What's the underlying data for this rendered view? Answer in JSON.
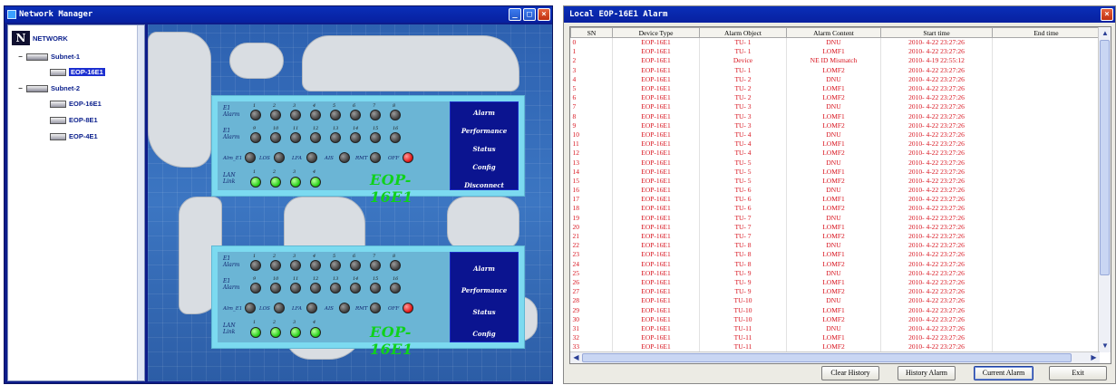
{
  "network_manager": {
    "title": "Network Manager",
    "tree": {
      "root": "NETWORK",
      "subnets": [
        {
          "label": "Subnet-1",
          "devices": [
            "EOP-16E1"
          ]
        },
        {
          "label": "Subnet-2",
          "devices": [
            "EOP-16E1",
            "EOP-8E1",
            "EOP-4E1"
          ]
        }
      ]
    },
    "panels": [
      {
        "model": "EOP-16E1",
        "row1_label": "E1\nAlarm",
        "row2_label": "E1\nAlarm",
        "row1_numbers": [
          "1",
          "2",
          "3",
          "4",
          "5",
          "6",
          "7",
          "8"
        ],
        "row2_numbers": [
          "9",
          "10",
          "11",
          "12",
          "13",
          "14",
          "15",
          "16"
        ],
        "status_labels": [
          "Alm_E1",
          "LOS",
          "LFA",
          "AIS",
          "RMT",
          "OFF"
        ],
        "lan_label": "LAN\nLink",
        "lan_numbers": [
          "1",
          "2",
          "3",
          "4"
        ],
        "menu": [
          "Alarm",
          "Performance",
          "Status",
          "Config",
          "Disconnect"
        ]
      },
      {
        "model": "EOP-16E1",
        "row1_label": "E1\nAlarm",
        "row2_label": "E1\nAlarm",
        "row1_numbers": [
          "1",
          "2",
          "3",
          "4",
          "5",
          "6",
          "7",
          "8"
        ],
        "row2_numbers": [
          "9",
          "10",
          "11",
          "12",
          "13",
          "14",
          "15",
          "16"
        ],
        "status_labels": [
          "Alm_E1",
          "LOS",
          "LFA",
          "AIS",
          "RMT",
          "OFF"
        ],
        "lan_label": "LAN\nLink",
        "lan_numbers": [
          "1",
          "2",
          "3",
          "4"
        ],
        "menu": [
          "Alarm",
          "Performance",
          "Status",
          "Config"
        ]
      }
    ]
  },
  "alarm_window": {
    "title": "Local EOP-16E1 Alarm",
    "columns": [
      "SN",
      "Device Type",
      "Alarm Object",
      "Alarm Content",
      "Start time",
      "End time"
    ],
    "rows": [
      [
        "0",
        "EOP-16E1",
        "TU- 1",
        "DNU",
        "2010- 4-22 23:27:26",
        ""
      ],
      [
        "1",
        "EOP-16E1",
        "TU- 1",
        "LOMF1",
        "2010- 4-22 23:27:26",
        ""
      ],
      [
        "2",
        "EOP-16E1",
        "Device",
        "NE ID Mismatch",
        "2010- 4-19 22:55:12",
        ""
      ],
      [
        "3",
        "EOP-16E1",
        "TU- 1",
        "LOMF2",
        "2010- 4-22 23:27:26",
        ""
      ],
      [
        "4",
        "EOP-16E1",
        "TU- 2",
        "DNU",
        "2010- 4-22 23:27:26",
        ""
      ],
      [
        "5",
        "EOP-16E1",
        "TU- 2",
        "LOMF1",
        "2010- 4-22 23:27:26",
        ""
      ],
      [
        "6",
        "EOP-16E1",
        "TU- 2",
        "LOMF2",
        "2010- 4-22 23:27:26",
        ""
      ],
      [
        "7",
        "EOP-16E1",
        "TU- 3",
        "DNU",
        "2010- 4-22 23:27:26",
        ""
      ],
      [
        "8",
        "EOP-16E1",
        "TU- 3",
        "LOMF1",
        "2010- 4-22 23:27:26",
        ""
      ],
      [
        "9",
        "EOP-16E1",
        "TU- 3",
        "LOMF2",
        "2010- 4-22 23:27:26",
        ""
      ],
      [
        "10",
        "EOP-16E1",
        "TU- 4",
        "DNU",
        "2010- 4-22 23:27:26",
        ""
      ],
      [
        "11",
        "EOP-16E1",
        "TU- 4",
        "LOMF1",
        "2010- 4-22 23:27:26",
        ""
      ],
      [
        "12",
        "EOP-16E1",
        "TU- 4",
        "LOMF2",
        "2010- 4-22 23:27:26",
        ""
      ],
      [
        "13",
        "EOP-16E1",
        "TU- 5",
        "DNU",
        "2010- 4-22 23:27:26",
        ""
      ],
      [
        "14",
        "EOP-16E1",
        "TU- 5",
        "LOMF1",
        "2010- 4-22 23:27:26",
        ""
      ],
      [
        "15",
        "EOP-16E1",
        "TU- 5",
        "LOMF2",
        "2010- 4-22 23:27:26",
        ""
      ],
      [
        "16",
        "EOP-16E1",
        "TU- 6",
        "DNU",
        "2010- 4-22 23:27:26",
        ""
      ],
      [
        "17",
        "EOP-16E1",
        "TU- 6",
        "LOMF1",
        "2010- 4-22 23:27:26",
        ""
      ],
      [
        "18",
        "EOP-16E1",
        "TU- 6",
        "LOMF2",
        "2010- 4-22 23:27:26",
        ""
      ],
      [
        "19",
        "EOP-16E1",
        "TU- 7",
        "DNU",
        "2010- 4-22 23:27:26",
        ""
      ],
      [
        "20",
        "EOP-16E1",
        "TU- 7",
        "LOMF1",
        "2010- 4-22 23:27:26",
        ""
      ],
      [
        "21",
        "EOP-16E1",
        "TU- 7",
        "LOMF2",
        "2010- 4-22 23:27:26",
        ""
      ],
      [
        "22",
        "EOP-16E1",
        "TU- 8",
        "DNU",
        "2010- 4-22 23:27:26",
        ""
      ],
      [
        "23",
        "EOP-16E1",
        "TU- 8",
        "LOMF1",
        "2010- 4-22 23:27:26",
        ""
      ],
      [
        "24",
        "EOP-16E1",
        "TU- 8",
        "LOMF2",
        "2010- 4-22 23:27:26",
        ""
      ],
      [
        "25",
        "EOP-16E1",
        "TU- 9",
        "DNU",
        "2010- 4-22 23:27:26",
        ""
      ],
      [
        "26",
        "EOP-16E1",
        "TU- 9",
        "LOMF1",
        "2010- 4-22 23:27:26",
        ""
      ],
      [
        "27",
        "EOP-16E1",
        "TU- 9",
        "LOMF2",
        "2010- 4-22 23:27:26",
        ""
      ],
      [
        "28",
        "EOP-16E1",
        "TU-10",
        "DNU",
        "2010- 4-22 23:27:26",
        ""
      ],
      [
        "29",
        "EOP-16E1",
        "TU-10",
        "LOMF1",
        "2010- 4-22 23:27:26",
        ""
      ],
      [
        "30",
        "EOP-16E1",
        "TU-10",
        "LOMF2",
        "2010- 4-22 23:27:26",
        ""
      ],
      [
        "31",
        "EOP-16E1",
        "TU-11",
        "DNU",
        "2010- 4-22 23:27:26",
        ""
      ],
      [
        "32",
        "EOP-16E1",
        "TU-11",
        "LOMF1",
        "2010- 4-22 23:27:26",
        ""
      ],
      [
        "33",
        "EOP-16E1",
        "TU-11",
        "LOMF2",
        "2010- 4-22 23:27:26",
        ""
      ]
    ],
    "buttons": [
      "Clear History",
      "History Alarm",
      "Current Alarm",
      "Exit"
    ],
    "active_button": "Current Alarm"
  },
  "colors": {
    "title_bar": "#0720a0",
    "alarm_text": "#d8121d",
    "led_green": "#1fcc10",
    "led_red": "#e01010",
    "panel_bg": "#7cdaf0",
    "menu_bg": "#0b1490",
    "model_text": "#0fd21b"
  },
  "icons": {
    "tree_root": "network-logo-icon",
    "subnet": "subnet-icon",
    "device": "device-icon",
    "close": "close-icon"
  }
}
